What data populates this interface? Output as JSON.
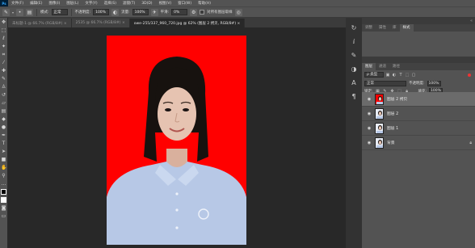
{
  "app": {
    "logo": "Ps"
  },
  "menu": [
    "文件(F)",
    "编辑(E)",
    "图像(I)",
    "图层(L)",
    "文字(Y)",
    "选择(S)",
    "滤镜(T)",
    "3D(D)",
    "视图(V)",
    "窗口(W)",
    "帮助(H)"
  ],
  "options": {
    "mode_label": "模式:",
    "mode_value": "正常",
    "opacity_label": "不透明度:",
    "opacity_value": "100%",
    "flow_label": "流量:",
    "flow_value": "100%",
    "smooth_label": "平滑:",
    "smooth_value": "0%",
    "sample_all_label": "对所有图层取样"
  },
  "tabs": [
    {
      "label": "未标题-1 @ 66.7% (RGB/8#) ×"
    },
    {
      "label": "2535 @ 66.7% (RGB/8#) ×"
    },
    {
      "label": "owe-255/337_960_720.jpg @ 62% (图层 2 拷贝, RGB/8#) ×"
    }
  ],
  "dock": {
    "top_tabs": [
      "调整",
      "属性",
      "库",
      "样式"
    ],
    "top_active": "样式"
  },
  "layers_panel": {
    "tabs": [
      "图层",
      "通道",
      "路径"
    ],
    "filter_kind": "ρ 类型",
    "blend_mode": "正常",
    "opacity_label": "不透明度:",
    "opacity_value": "100%",
    "lock_label": "锁定:",
    "fill_label": "填充:",
    "fill_value": "100%",
    "layers": [
      {
        "name": "图层 2 拷贝",
        "selected": true,
        "locked": false
      },
      {
        "name": "图层 2",
        "selected": false,
        "locked": false
      },
      {
        "name": "图层 1",
        "selected": false,
        "locked": false
      },
      {
        "name": "背景",
        "selected": false,
        "locked": true
      }
    ]
  },
  "colors": {
    "photo_background": "#ff0000",
    "shirt": "#b7c8e6",
    "hair": "#17120f",
    "skin": "#e6c3b1",
    "foreground_swatch": "#000000",
    "background_swatch": "#ffffff"
  },
  "icons": {
    "tools": [
      "move-icon",
      "marquee-icon",
      "lasso-icon",
      "quick-select-icon",
      "crop-icon",
      "eyedropper-icon",
      "healing-icon",
      "brush-icon",
      "clone-stamp-icon",
      "history-brush-icon",
      "eraser-icon",
      "gradient-icon",
      "blur-icon",
      "dodge-icon",
      "pen-icon",
      "type-icon",
      "path-select-icon",
      "rectangle-icon",
      "hand-icon",
      "zoom-icon"
    ]
  }
}
